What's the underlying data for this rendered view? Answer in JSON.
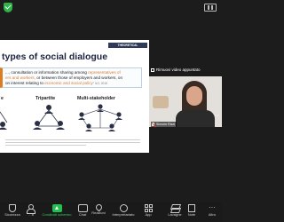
{
  "slide": {
    "tag": "THEORETICAL FRAMEWORK",
    "title": "types of social dialogue",
    "def_plain_1": "..., consultation or information sharing among ",
    "def_hl_1": "representatives of",
    "def_hl_2": "ers and workers,",
    "def_plain_2": " or between those of employers and workers, on",
    "def_plain_3": "on interest relating to ",
    "def_hl_3": "economic and social policy",
    "def_cite": "\" ILO, 2015",
    "label_bipartite": "e",
    "label_tripartite": "Tripartite",
    "label_multistakeholder": "Multi-stakeholder"
  },
  "video": {
    "header": "Rimuovi video appuntato",
    "participant_name": "Simone Rizzi",
    "more": "···"
  },
  "toolbar": {
    "items": [
      {
        "label": "Sicurezza",
        "icon": "shield-icon"
      },
      {
        "label": "…ti",
        "icon": "participants-icon"
      },
      {
        "label": "Condividi schermo",
        "icon": "share-screen-icon",
        "color": "#2fd15a"
      },
      {
        "label": "Chat",
        "icon": "chat-icon"
      },
      {
        "label": "Reazioni",
        "icon": "reactions-icon"
      },
      {
        "label": "Interpretariato",
        "icon": "interpretation-icon"
      },
      {
        "label": "App",
        "icon": "apps-icon"
      },
      {
        "label": "Lavagne",
        "icon": "whiteboard-icon"
      },
      {
        "label": "Note",
        "icon": "notes-icon"
      },
      {
        "label": "Altro",
        "icon": "more-icon"
      }
    ]
  },
  "colors": {
    "accent_green": "#2fd15a",
    "slide_navy": "#1d2440",
    "highlight_orange": "#d97a2b"
  }
}
